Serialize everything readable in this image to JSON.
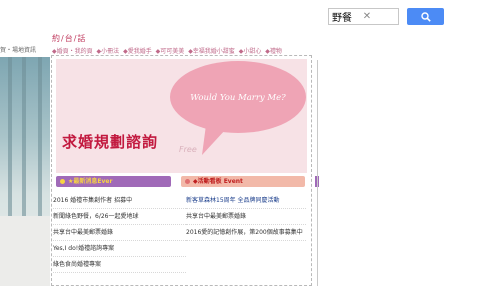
{
  "search": {
    "value": "野餐",
    "clear_symbol": "✕"
  },
  "header": {
    "top_left_nav": "賀・場地資訊",
    "site_title": "約/台/話",
    "breadcrumb": [
      "◆婚頁・我的頁",
      "◆小冊法",
      "◆愛我婚手",
      "◆可可美美",
      "◆幸福我婚小甜蜜",
      "◆小甜心",
      "◆禮物"
    ]
  },
  "banner": {
    "title": "求婚規劃諮詢",
    "free_label": "Free",
    "bubble_text": "Would You Marry Me?"
  },
  "panels": {
    "left_label": "★最新消息Ever",
    "right_label": "◆活動看板 Event",
    "left_items": [
      "2016 婚禮市集創作者 招募中",
      "新聞綠色野餐，6/26一起愛地球",
      "共享台中最美郵票婚錄",
      "Yes,I do!婚禮諮詢專案",
      "綠色食尚婚禮專案"
    ],
    "right_items": [
      "新客草森林15周年 全品牌同慶活動",
      "共享台中最美郵票婚錄",
      "2016愛的記憶創作展，第200個故事募集中"
    ]
  },
  "colors": {
    "accent_pink": "#c2193f",
    "banner_bg": "#f7e2e6",
    "bubble": "#efa4b5",
    "purple_tab": "#a06ab8",
    "salmon_tab": "#f2b9a9",
    "search_button": "#4c8bf5"
  }
}
